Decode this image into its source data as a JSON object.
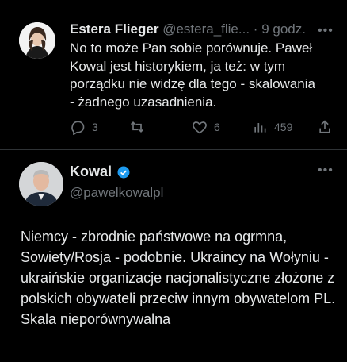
{
  "reply": {
    "author_name": "Estera Flieger",
    "author_handle": "@estera_flie...",
    "separator": "·",
    "time": "9 godz.",
    "text": "No to może Pan sobie porównuje. Paweł Kowal jest historykiem, ja też: w tym porządku nie widzę dla tego - skalowania - żadnego uzasadnienia.",
    "stats": {
      "replies": "3",
      "retweets": "",
      "likes": "6",
      "views": "459"
    }
  },
  "main": {
    "author_name": "Kowal",
    "author_handle": "@pawelkowalpl",
    "text": "Niemcy - zbrodnie państwowe na ogrmna, Sowiety/Rosja - podobnie. Ukraincy na Wołyniu - ukraińskie organizacje nacjonalistyczne złożone z polskich obywateli przeciw innym obywatelom PL. Skala nieporównywalna",
    "verified": true
  },
  "colors": {
    "background": "#000000",
    "text": "#e7e9ea",
    "muted": "#71767b",
    "verified": "#1d9bf0",
    "divider": "#2f3336"
  },
  "icons": [
    "reply-icon",
    "retweet-icon",
    "like-icon",
    "views-icon",
    "share-icon",
    "more-icon",
    "verified-badge-icon"
  ]
}
